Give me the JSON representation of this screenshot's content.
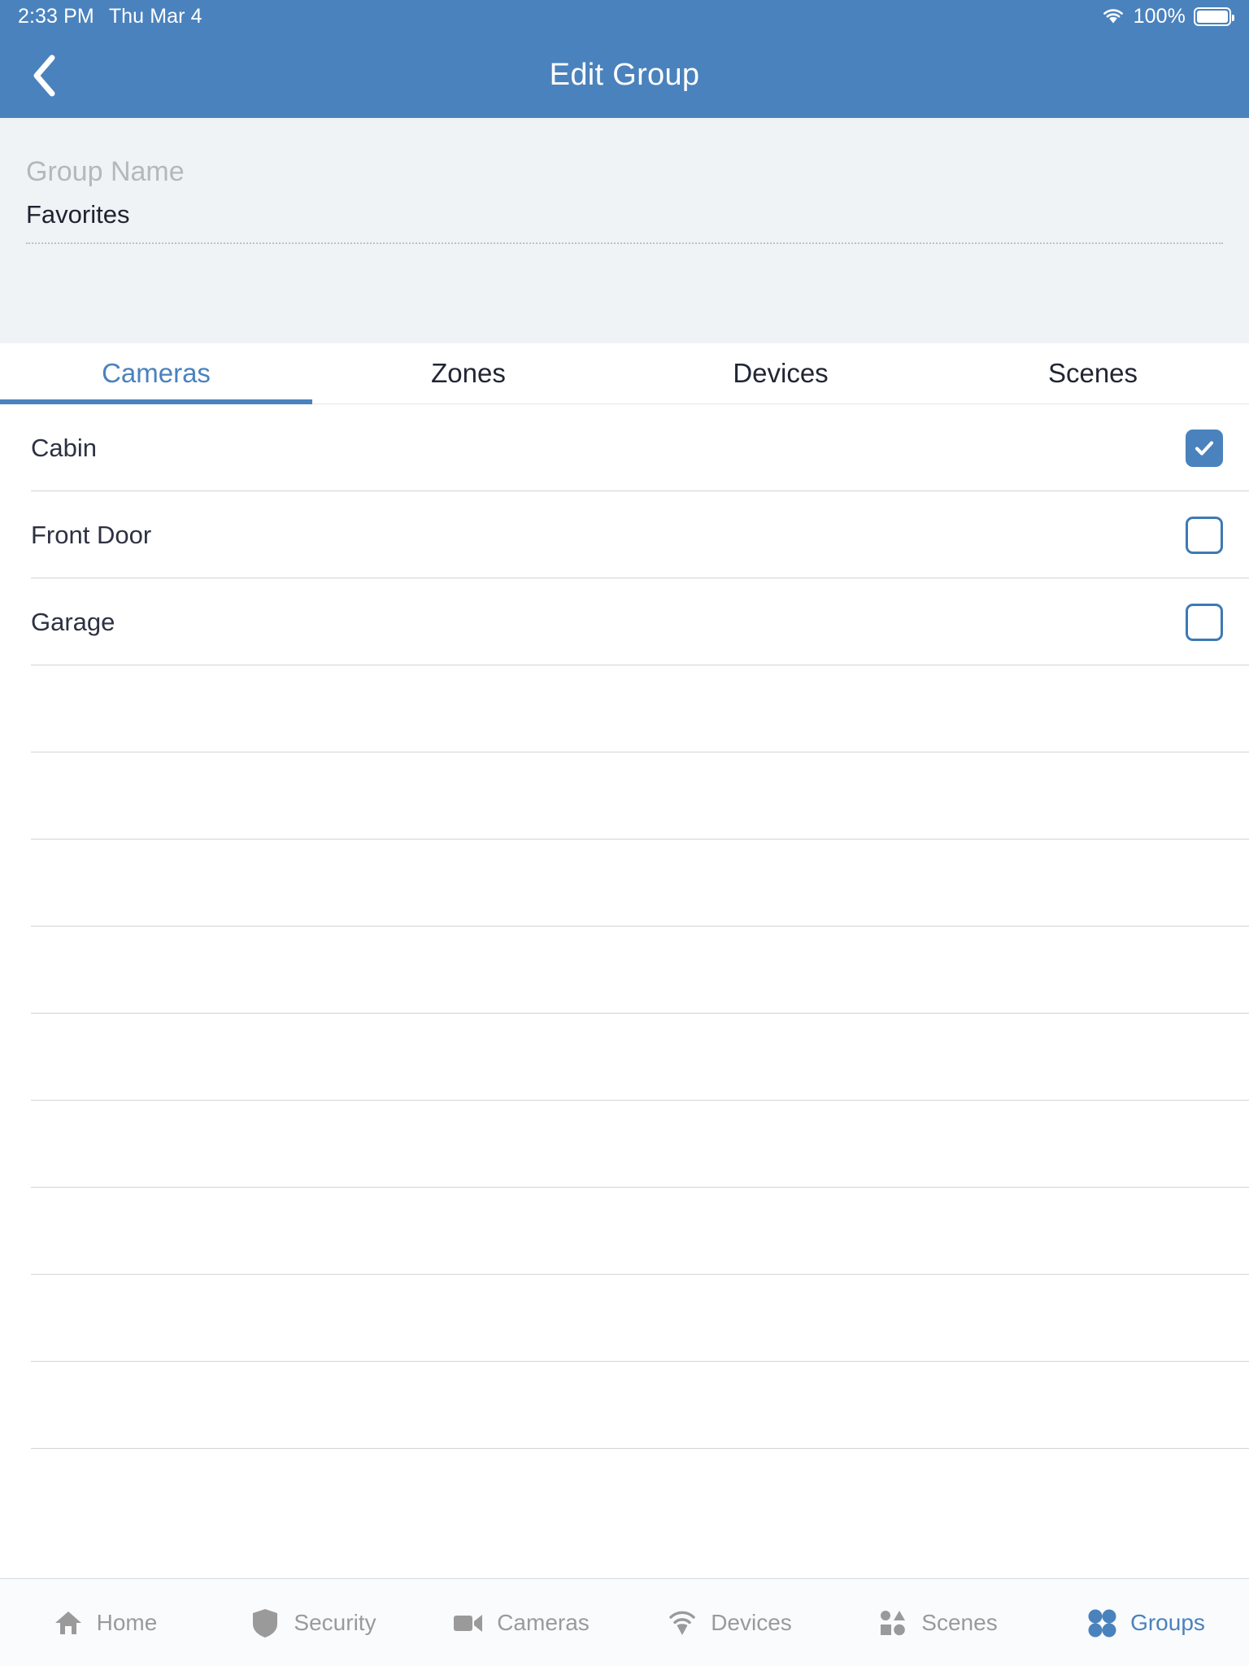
{
  "statusbar": {
    "time": "2:33 PM",
    "date": "Thu Mar 4",
    "battery_percent": "100%",
    "wifi_icon": "wifi-icon",
    "battery_icon": "battery-icon"
  },
  "header": {
    "title": "Edit Group",
    "back_icon": "chevron-left-icon",
    "background_color": "#4a82bd"
  },
  "group_name_field": {
    "label": "Group Name",
    "value": "Favorites",
    "placeholder": "Group Name"
  },
  "tabs": [
    {
      "label": "Cameras",
      "active": true
    },
    {
      "label": "Zones",
      "active": false
    },
    {
      "label": "Devices",
      "active": false
    },
    {
      "label": "Scenes",
      "active": false
    }
  ],
  "list": {
    "rows": [
      {
        "label": "Cabin",
        "checked": true
      },
      {
        "label": "Front Door",
        "checked": false
      },
      {
        "label": "Garage",
        "checked": false
      }
    ],
    "empty_row_count": 9
  },
  "bottom_nav": [
    {
      "label": "Home",
      "icon": "house-icon",
      "active": false
    },
    {
      "label": "Security",
      "icon": "shield-icon",
      "active": false
    },
    {
      "label": "Cameras",
      "icon": "video-camera-icon",
      "active": false
    },
    {
      "label": "Devices",
      "icon": "signal-icon",
      "active": false
    },
    {
      "label": "Scenes",
      "icon": "shapes-icon",
      "active": false
    },
    {
      "label": "Groups",
      "icon": "four-dots-icon",
      "active": true
    }
  ],
  "colors": {
    "accent": "#4a82bd",
    "field_bg": "#eff3f6",
    "label_gray": "#b4b8bb",
    "text_dark": "#2d3142",
    "nav_inactive": "#9a9a9a"
  }
}
